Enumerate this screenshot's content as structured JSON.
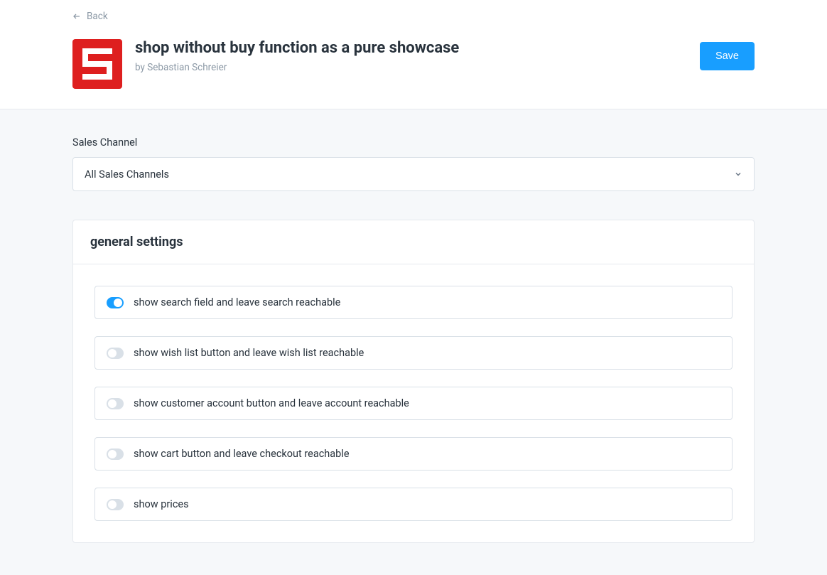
{
  "header": {
    "back_label": "Back",
    "title": "shop without buy function as a pure showcase",
    "byline": "by Sebastian Schreier",
    "save_label": "Save"
  },
  "sales_channel": {
    "label": "Sales Channel",
    "selected": "All Sales Channels"
  },
  "settings_card": {
    "title": "general settings"
  },
  "toggles": [
    {
      "label": "show search field and leave search reachable",
      "on": true
    },
    {
      "label": "show wish list button and leave wish list reachable",
      "on": false
    },
    {
      "label": "show customer account button and leave account reachable",
      "on": false
    },
    {
      "label": "show cart button and leave checkout reachable",
      "on": false
    },
    {
      "label": "show prices",
      "on": false
    }
  ]
}
